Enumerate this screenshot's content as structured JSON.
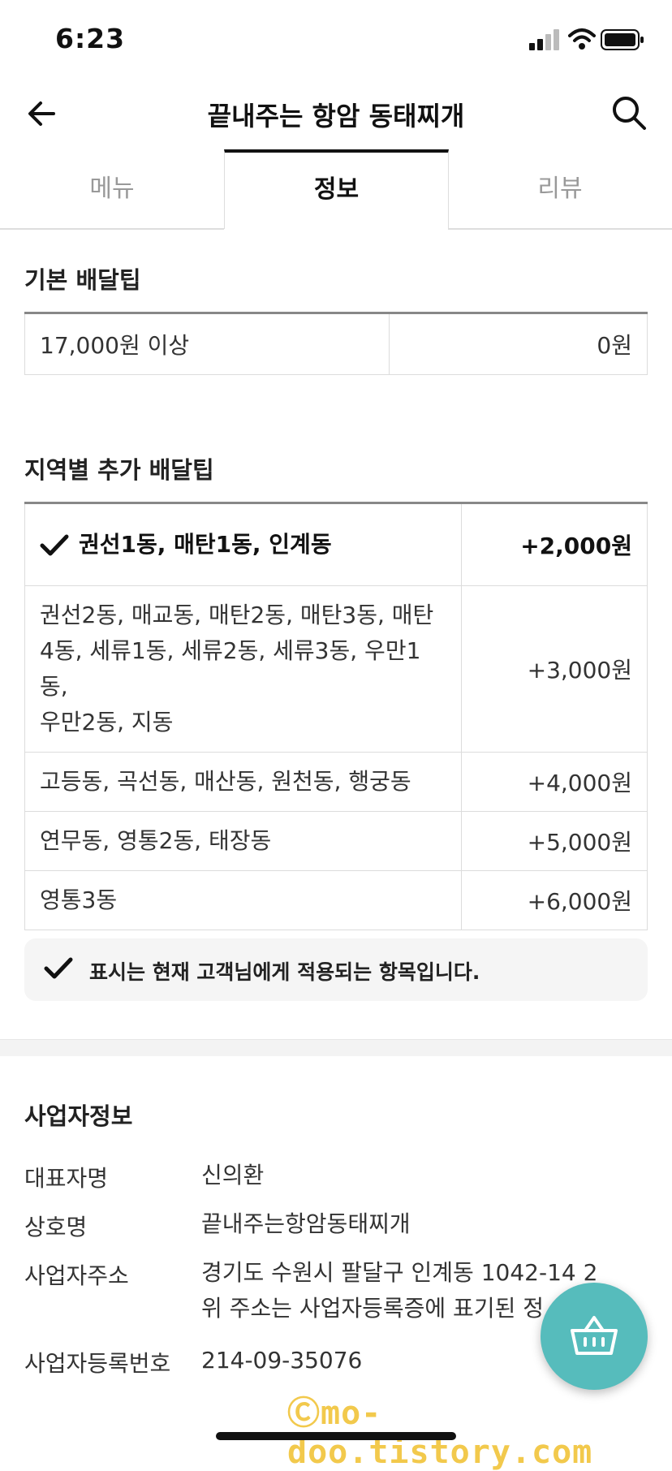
{
  "status_bar": {
    "time": "6:23"
  },
  "header": {
    "title": "끝내주는 항암 동태찌개",
    "back_icon": "arrow-left-icon",
    "search_icon": "search-icon"
  },
  "tabs": [
    {
      "label": "메뉴",
      "active": false
    },
    {
      "label": "정보",
      "active": true
    },
    {
      "label": "리뷰",
      "active": false
    }
  ],
  "basic_delivery": {
    "title": "기본 배달팁",
    "rows": [
      {
        "condition": "17,000원 이상",
        "fee": "0원"
      }
    ]
  },
  "regional_delivery": {
    "title": "지역별 추가 배달팁",
    "rows": [
      {
        "areas": "권선1동, 매탄1동, 인계동",
        "fee": "+2,000원",
        "selected": true
      },
      {
        "areas_lines": [
          "권선2동, 매교동, 매탄2동, 매탄3동, 매탄",
          "4동, 세류1동, 세류2동, 세류3동, 우만1동,",
          "우만2동, 지동"
        ],
        "fee": "+3,000원",
        "selected": false
      },
      {
        "areas": "고등동, 곡선동, 매산동, 원천동, 행궁동",
        "fee": "+4,000원",
        "selected": false
      },
      {
        "areas": "연무동, 영통2동, 태장동",
        "fee": "+5,000원",
        "selected": false
      },
      {
        "areas": "영통3동",
        "fee": "+6,000원",
        "selected": false
      }
    ]
  },
  "notice": {
    "text": "표시는 현재 고객님에게 적용되는 항목입니다.",
    "icon": "check-icon"
  },
  "business_info": {
    "title": "사업자정보",
    "rows": [
      {
        "label": "대표자명",
        "value": "신의환"
      },
      {
        "label": "상호명",
        "value": "끝내주는항암동태찌개"
      },
      {
        "label": "사업자주소",
        "value_lines": [
          "경기도 수원시 팔달구 인계동 1042-14 2",
          "위 주소는 사업자등록증에 표기된 정"
        ]
      },
      {
        "label": "사업자등록번호",
        "value": "214-09-35076"
      }
    ]
  },
  "cart_button": {
    "icon": "basket-icon"
  },
  "watermark": "Ⓒmo-doo.tistory.com",
  "colors": {
    "accent": "#56bcbc",
    "text": "#222222",
    "watermark": "#f2c94c"
  }
}
